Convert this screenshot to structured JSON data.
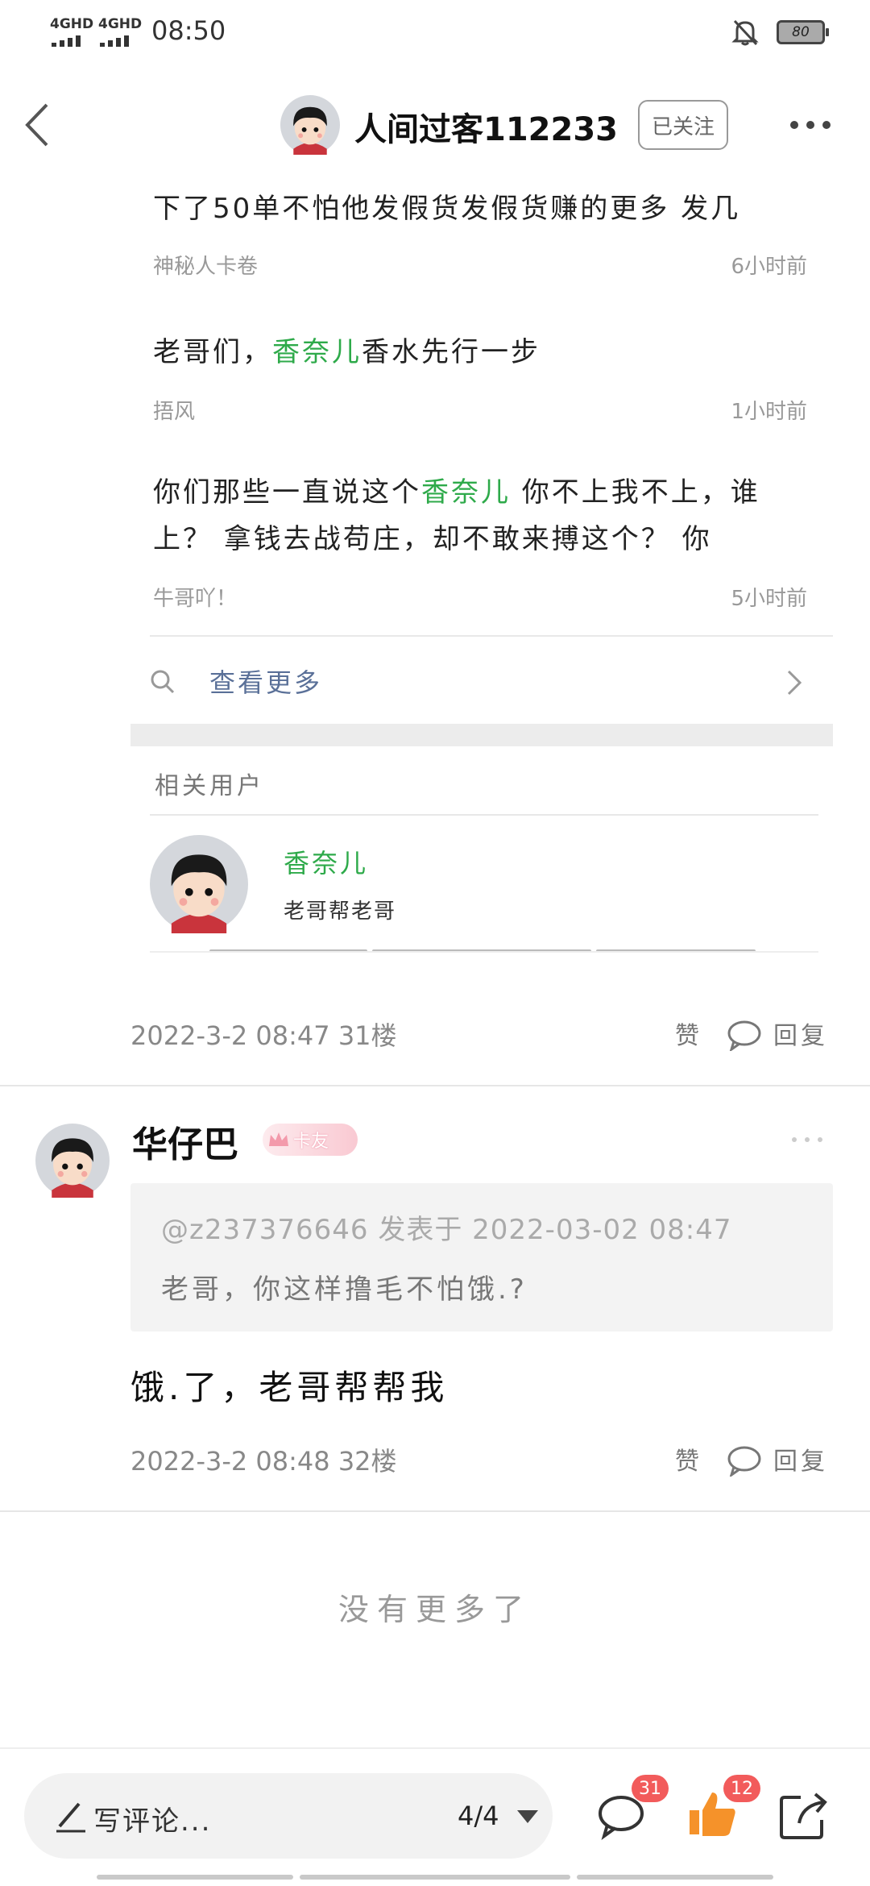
{
  "status_bar": {
    "network_1": "4GHD",
    "network_2": "4GHD",
    "time": "08:50",
    "battery": "80"
  },
  "header": {
    "title": "人间过客112233",
    "follow_label": "已关注"
  },
  "results": [
    {
      "text_parts": [
        "下了50单不怕他发假货发假货赚的更多 发几"
      ],
      "author": "神秘人卡卷",
      "time": "6小时前"
    },
    {
      "text_before": "老哥们，",
      "highlight": "香奈儿",
      "text_after": "香水先行一步",
      "author": "捂风",
      "time": "1小时前"
    },
    {
      "line1_before": "你们那些一直说这个",
      "highlight": "香奈儿",
      "line1_after": " 你不上我不上，谁",
      "line2": "上？ 拿钱去战苟庄，却不敢来搏这个？ 你",
      "author": "牛哥吖！",
      "time": "5小时前"
    }
  ],
  "view_more_label": "查看更多",
  "related": {
    "title": "相关用户",
    "user_name": "香奈儿",
    "user_desc": "老哥帮老哥"
  },
  "post_31": {
    "date": "2022-3-2 08:47  31楼",
    "like": "赞",
    "reply": "回复"
  },
  "comment": {
    "name": "华仔巴",
    "badge": "卡友",
    "quote_source": "@z237376646 发表于 2022-03-02 08:47",
    "quote_text": "老哥，你这样撸毛不怕饿.?",
    "text": "饿.了，老哥帮帮我",
    "date": "2022-3-2 08:48  32楼",
    "like": "赞",
    "reply": "回复"
  },
  "no_more": "没有更多了",
  "bottom_bar": {
    "placeholder": "写评论...",
    "page": "4/4",
    "comment_count": "31",
    "like_count": "12"
  },
  "colors": {
    "highlight_green": "#2eaa4a",
    "link_blue": "#5a7098",
    "badge_red": "#f25b5b",
    "like_orange": "#f5922a"
  }
}
